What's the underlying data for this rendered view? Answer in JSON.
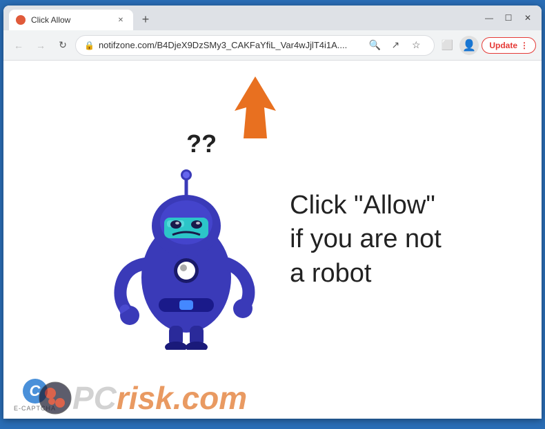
{
  "browser": {
    "tab": {
      "title": "Click Allow",
      "favicon_color": "#e05a3a"
    },
    "url": "notifzone.com/B4DjeX9DzSMy3_CAKFaYfiL_Var4wJjlT4i1A....",
    "update_button": "Update",
    "window_controls": {
      "minimize": "—",
      "maximize": "☐",
      "close": "✕"
    },
    "new_tab": "+"
  },
  "page": {
    "click_text_line1": "Click \"Allow\"",
    "click_text_line2": "if you are not",
    "click_text_line3": "a robot",
    "question_marks": "??",
    "ecaptcha_label": "E-CAPTCHA",
    "pcrisk_text": "PC",
    "pcrisk_suffix": "risk.com"
  },
  "icons": {
    "back": "←",
    "forward": "→",
    "reload": "↻",
    "lock": "🔒",
    "search": "🔍",
    "share": "↗",
    "star": "☆",
    "extensions": "⬜",
    "profile": "👤",
    "menu": "⋮"
  }
}
